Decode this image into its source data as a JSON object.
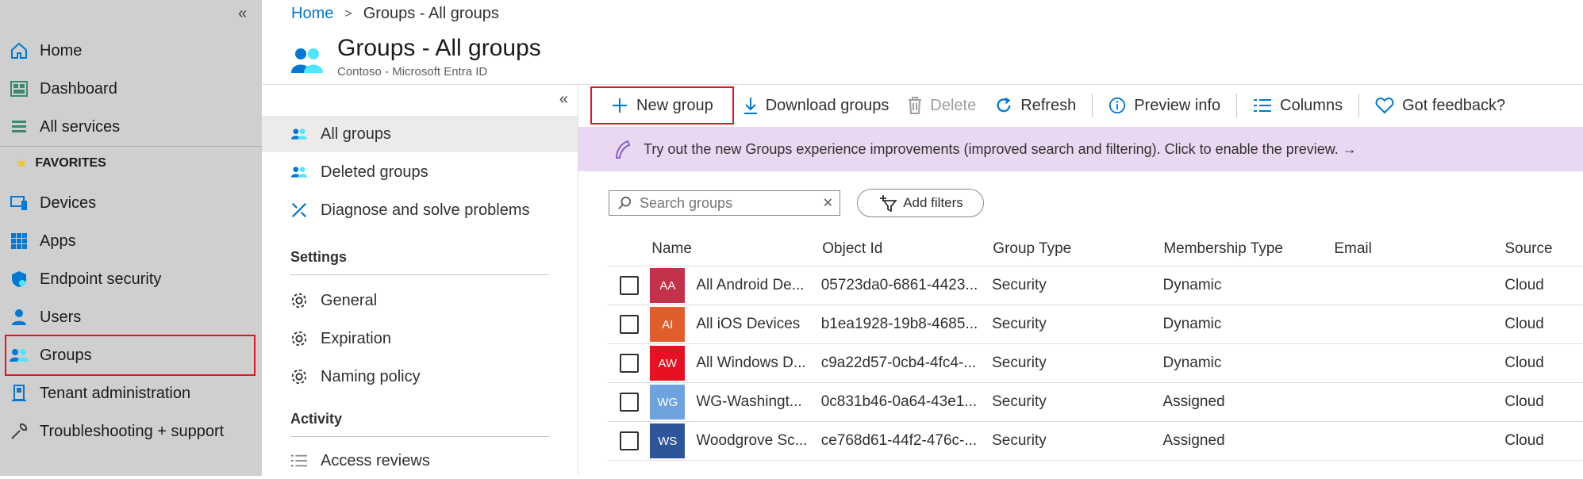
{
  "leftnav": {
    "items": [
      {
        "label": "Home",
        "icon": "home-icon"
      },
      {
        "label": "Dashboard",
        "icon": "dashboard-icon"
      },
      {
        "label": "All services",
        "icon": "all-services-icon"
      },
      {
        "label": "Devices",
        "icon": "devices-icon"
      },
      {
        "label": "Apps",
        "icon": "apps-icon"
      },
      {
        "label": "Endpoint security",
        "icon": "endpoint-security-icon"
      },
      {
        "label": "Users",
        "icon": "users-icon"
      },
      {
        "label": "Groups",
        "icon": "groups-icon"
      },
      {
        "label": "Tenant administration",
        "icon": "tenant-admin-icon"
      },
      {
        "label": "Troubleshooting + support",
        "icon": "wrench-icon"
      }
    ],
    "favorites_label": "FAVORITES",
    "selected": "Groups"
  },
  "header": {
    "breadcrumb": [
      "Home",
      "Groups - All groups"
    ],
    "title": "Groups - All groups",
    "subtitle": "Contoso - Microsoft Entra ID"
  },
  "subnav": {
    "items": [
      {
        "label": "All groups",
        "icon": "groups-icon"
      },
      {
        "label": "Deleted groups",
        "icon": "groups-icon"
      },
      {
        "label": "Diagnose and solve problems",
        "icon": "wrench-icon"
      }
    ],
    "settings_heading": "Settings",
    "settings": [
      {
        "label": "General",
        "icon": "gear-icon"
      },
      {
        "label": "Expiration",
        "icon": "gear-icon"
      },
      {
        "label": "Naming policy",
        "icon": "gear-icon"
      }
    ],
    "activity_heading": "Activity",
    "activity": [
      {
        "label": "Access reviews",
        "icon": "list-icon"
      }
    ]
  },
  "toolbar": {
    "new_group": "New group",
    "download_groups": "Download groups",
    "delete": "Delete",
    "refresh": "Refresh",
    "preview_info": "Preview info",
    "columns": "Columns",
    "feedback": "Got feedback?"
  },
  "banner": {
    "text": "Try out the new Groups experience improvements (improved search and filtering). Click to enable the preview. →"
  },
  "search": {
    "placeholder": "Search groups"
  },
  "filters": {
    "add_label": "Add filters"
  },
  "table": {
    "headers": [
      "Name",
      "Object Id",
      "Group Type",
      "Membership Type",
      "Email",
      "Source"
    ],
    "rows": [
      {
        "initials": "AA",
        "color": "#c4314b",
        "name": "All Android De...",
        "object_id": "05723da0-6861-4423...",
        "group_type": "Security",
        "membership": "Dynamic",
        "email": "",
        "source": "Cloud"
      },
      {
        "initials": "AI",
        "color": "#e05d2e",
        "name": "All iOS Devices",
        "object_id": "b1ea1928-19b8-4685...",
        "group_type": "Security",
        "membership": "Dynamic",
        "email": "",
        "source": "Cloud"
      },
      {
        "initials": "AW",
        "color": "#e81123",
        "name": "All Windows D...",
        "object_id": "c9a22d57-0cb4-4fc4-...",
        "group_type": "Security",
        "membership": "Dynamic",
        "email": "",
        "source": "Cloud"
      },
      {
        "initials": "WG",
        "color": "#6fa3e0",
        "name": "WG-Washingt...",
        "object_id": "0c831b46-0a64-43e1...",
        "group_type": "Security",
        "membership": "Assigned",
        "email": "",
        "source": "Cloud"
      },
      {
        "initials": "WS",
        "color": "#2e5599",
        "name": "Woodgrove Sc...",
        "object_id": "ce768d61-44f2-476c-...",
        "group_type": "Security",
        "membership": "Assigned",
        "email": "",
        "source": "Cloud"
      }
    ]
  }
}
